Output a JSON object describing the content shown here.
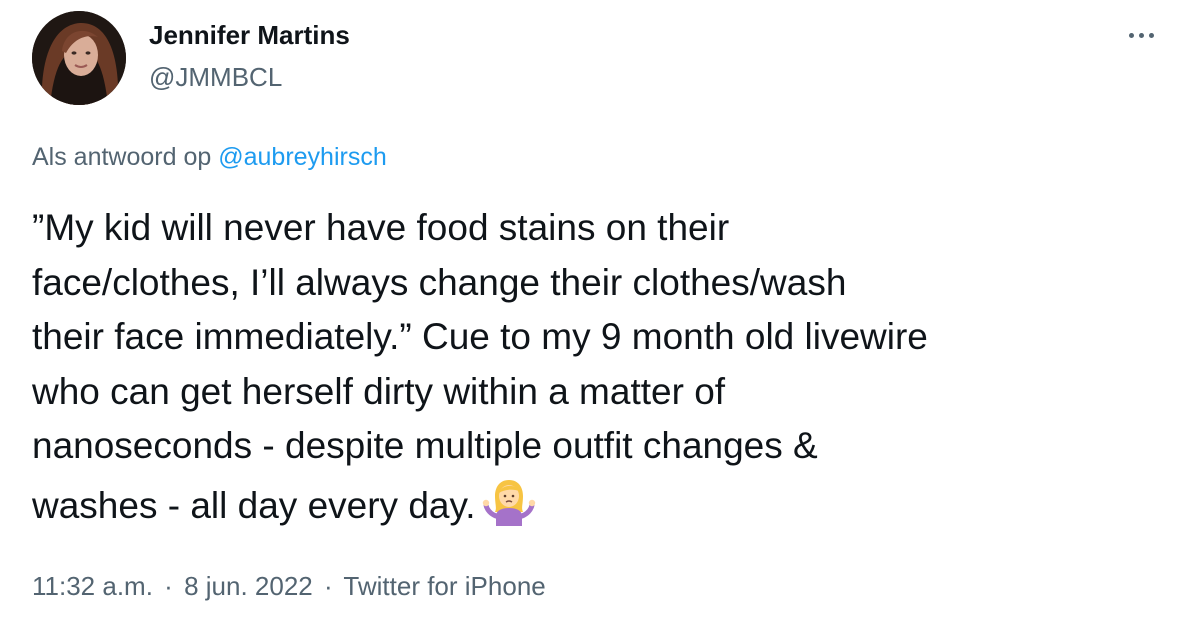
{
  "author": {
    "display_name": "Jennifer Martins",
    "handle": "@JMMBCL"
  },
  "reply": {
    "prefix": "Als antwoord op",
    "mention": "@aubreyhirsch"
  },
  "tweet": {
    "text": "”My kid will never have food stains on their\nface/clothes, I’ll always change their clothes/wash\ntheir face immediately.” Cue to my 9 month old livewire\nwho can get herself dirty within a matter of\nnanoseconds - despite multiple outfit changes &\nwashes - all day every day.",
    "emoji": "person-shrugging-emoji"
  },
  "meta": {
    "time": "11:32 a.m.",
    "separator": "·",
    "date": "8 jun. 2022",
    "source": "Twitter for iPhone"
  },
  "icons": {
    "more": "more-options-icon",
    "avatar": "profile-avatar"
  },
  "colors": {
    "text": "#0f1419",
    "secondary": "#536471",
    "link": "#1d9bf0"
  }
}
